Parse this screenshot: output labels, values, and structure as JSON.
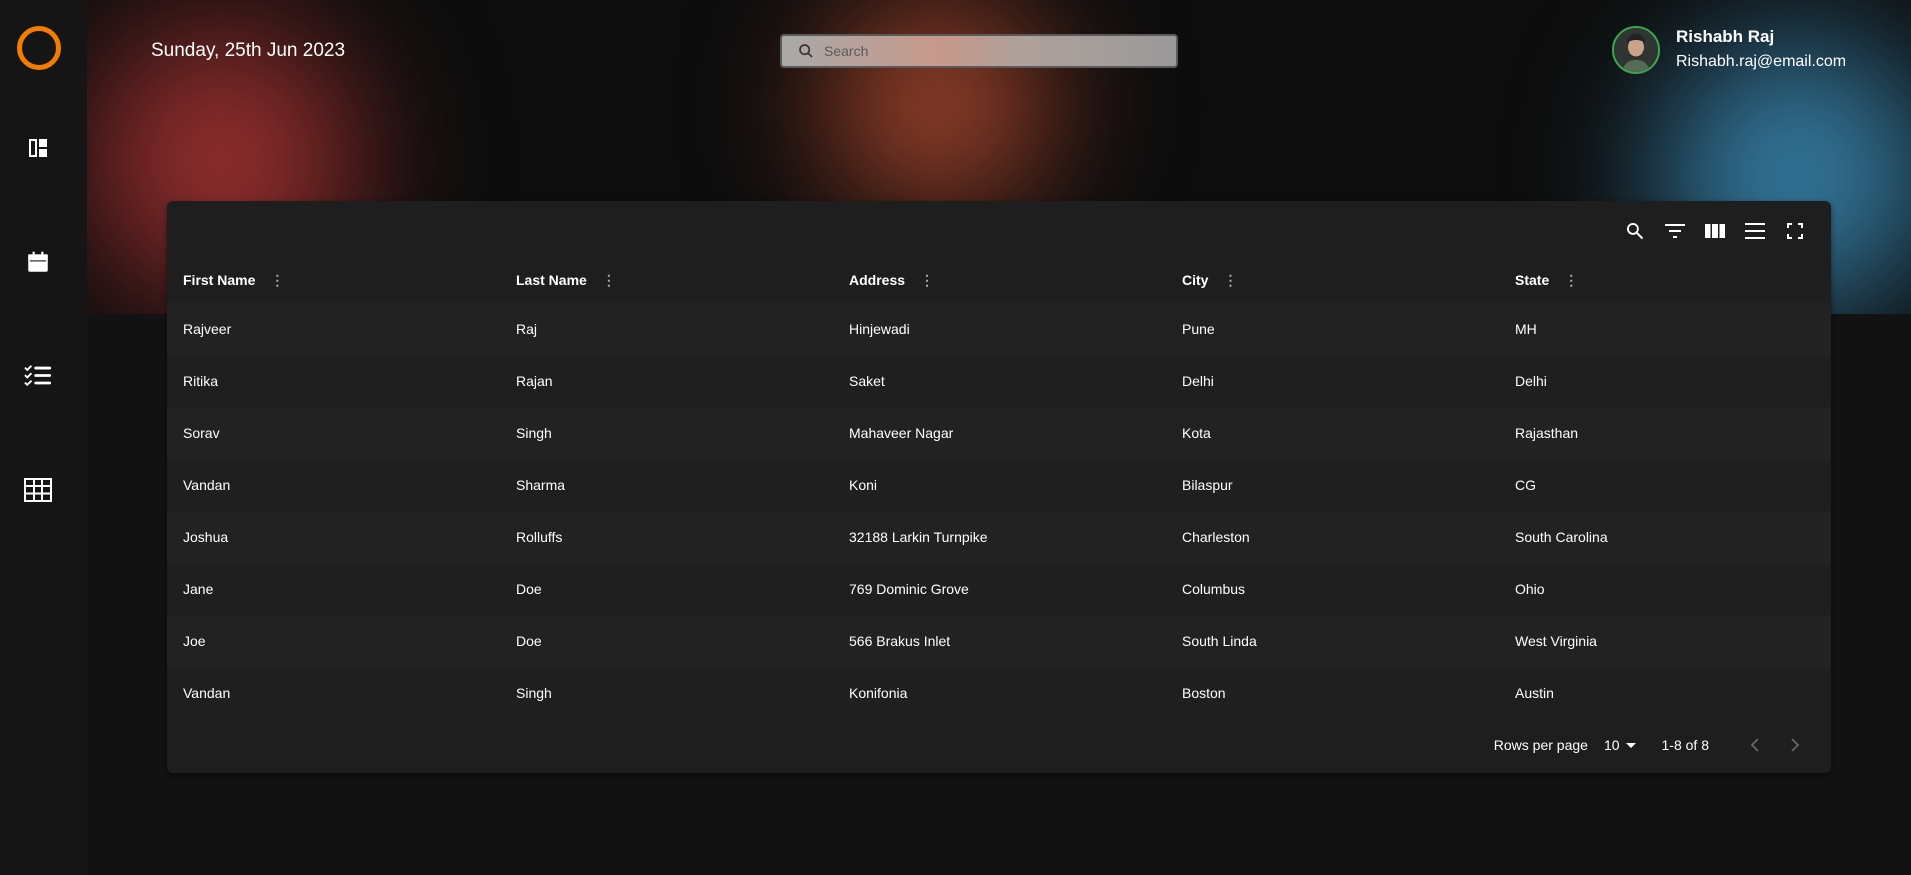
{
  "header": {
    "date": "Sunday, 25th Jun 2023",
    "search_placeholder": "Search",
    "user_name": "Rishabh Raj",
    "user_email": "Rishabh.raj@email.com"
  },
  "sidebar": {
    "items": [
      {
        "icon": "dashboard-icon"
      },
      {
        "icon": "calendar-icon"
      },
      {
        "icon": "checklist-icon"
      },
      {
        "icon": "table-icon"
      }
    ]
  },
  "table": {
    "columns": [
      "First Name",
      "Last Name",
      "Address",
      "City",
      "State"
    ],
    "rows": [
      [
        "Rajveer",
        "Raj",
        "Hinjewadi",
        "Pune",
        "MH"
      ],
      [
        "Ritika",
        "Rajan",
        "Saket",
        "Delhi",
        "Delhi"
      ],
      [
        "Sorav",
        "Singh",
        "Mahaveer Nagar",
        "Kota",
        "Rajasthan"
      ],
      [
        "Vandan",
        "Sharma",
        "Koni",
        "Bilaspur",
        "CG"
      ],
      [
        "Joshua",
        "Rolluffs",
        "32188 Larkin Turnpike",
        "Charleston",
        "South Carolina"
      ],
      [
        "Jane",
        "Doe",
        "769 Dominic Grove",
        "Columbus",
        "Ohio"
      ],
      [
        "Joe",
        "Doe",
        "566 Brakus Inlet",
        "South Linda",
        "West Virginia"
      ],
      [
        "Vandan",
        "Singh",
        "Konifonia",
        "Boston",
        "Austin"
      ]
    ]
  },
  "pagination": {
    "rows_per_page_label": "Rows per page",
    "rows_per_page_value": "10",
    "range": "1-8 of 8"
  },
  "colors": {
    "accent": "#f57c00",
    "avatar_ring": "#3aa94b"
  }
}
